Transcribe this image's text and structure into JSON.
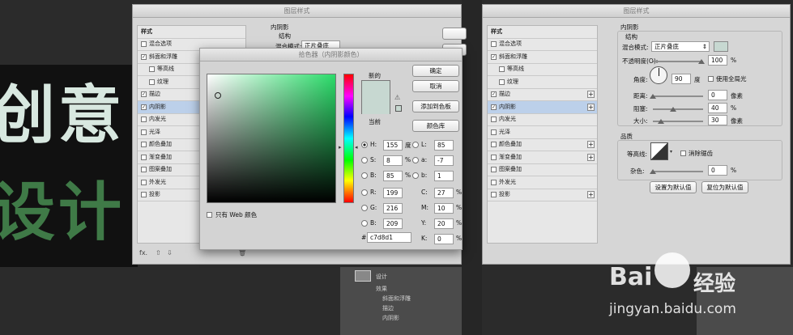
{
  "layer_style_left": {
    "title": "图层样式",
    "styles_header": "样式",
    "items": [
      {
        "label": "混合选项",
        "checked": false
      },
      {
        "label": "斜面和浮雕",
        "checked": true
      },
      {
        "label": "等高线",
        "checked": false
      },
      {
        "label": "纹理",
        "checked": false
      },
      {
        "label": "描边",
        "checked": true
      },
      {
        "label": "内阴影",
        "checked": true
      },
      {
        "label": "内发光",
        "checked": false
      },
      {
        "label": "光泽",
        "checked": false
      },
      {
        "label": "颜色叠加",
        "checked": false
      },
      {
        "label": "渐变叠加",
        "checked": false
      },
      {
        "label": "图案叠加",
        "checked": false
      },
      {
        "label": "外发光",
        "checked": false
      },
      {
        "label": "投影",
        "checked": false
      }
    ],
    "section_title": "内阴影",
    "structure": "结构",
    "blend_mode_label": "混合模式:",
    "blend_mode_value": "正片叠底",
    "fx_label": "fx."
  },
  "color_picker": {
    "title": "拾色器（内阴影颜色）",
    "new_label": "新的",
    "current_label": "当前",
    "ok_button": "确定",
    "cancel_button": "取消",
    "add_swatch_button": "添加到色板",
    "libraries_button": "颜色库",
    "web_only_label": "只有 Web 颜色",
    "hsb": [
      {
        "key": "H:",
        "value": "155",
        "unit": "度"
      },
      {
        "key": "S:",
        "value": "8",
        "unit": "%"
      },
      {
        "key": "B:",
        "value": "85",
        "unit": "%"
      }
    ],
    "rgb": [
      {
        "key": "R:",
        "value": "199"
      },
      {
        "key": "G:",
        "value": "216"
      },
      {
        "key": "B:",
        "value": "209"
      }
    ],
    "lab": [
      {
        "key": "L:",
        "value": "85"
      },
      {
        "key": "a:",
        "value": "-7"
      },
      {
        "key": "b:",
        "value": "1"
      }
    ],
    "cmyk": [
      {
        "key": "C:",
        "value": "27",
        "unit": "%"
      },
      {
        "key": "M:",
        "value": "10",
        "unit": "%"
      },
      {
        "key": "Y:",
        "value": "20",
        "unit": "%"
      },
      {
        "key": "K:",
        "value": "0",
        "unit": "%"
      }
    ],
    "hex_label": "#",
    "hex_value": "c7d8d1",
    "swatch_color": "#c7d8d1"
  },
  "layer_style_right": {
    "title": "图层样式",
    "styles_header": "样式",
    "items": [
      {
        "label": "混合选项",
        "checked": false,
        "plus": false
      },
      {
        "label": "斜面和浮雕",
        "checked": true,
        "plus": false
      },
      {
        "label": "等高线",
        "checked": false,
        "plus": false
      },
      {
        "label": "纹理",
        "checked": false,
        "plus": false
      },
      {
        "label": "描边",
        "checked": true,
        "plus": true
      },
      {
        "label": "内阴影",
        "checked": true,
        "plus": true
      },
      {
        "label": "内发光",
        "checked": false,
        "plus": false
      },
      {
        "label": "光泽",
        "checked": false,
        "plus": false
      },
      {
        "label": "颜色叠加",
        "checked": false,
        "plus": true
      },
      {
        "label": "渐变叠加",
        "checked": false,
        "plus": true
      },
      {
        "label": "图案叠加",
        "checked": false,
        "plus": false
      },
      {
        "label": "外发光",
        "checked": false,
        "plus": false
      },
      {
        "label": "投影",
        "checked": false,
        "plus": true
      }
    ],
    "section_title": "内阴影",
    "structure": "结构",
    "blend_mode_label": "混合模式:",
    "blend_mode_value": "正片叠底",
    "opacity_label": "不透明度(O):",
    "opacity_value": "100",
    "angle_label": "角度:",
    "angle_value": "90",
    "angle_unit": "度",
    "global_light_label": "使用全局光",
    "distance_label": "距离:",
    "distance_value": "0",
    "choke_label": "阻塞:",
    "choke_value": "40",
    "size_label": "大小:",
    "size_value": "30",
    "px_unit": "像素",
    "pct_unit": "%",
    "quality_title": "品质",
    "contour_label": "等高线:",
    "antialias_label": "消除锯齿",
    "noise_label": "杂色:",
    "noise_value": "0",
    "default_button": "设置为默认值",
    "reset_button": "复位为默认值"
  },
  "canvas_text": {
    "line1": "创意",
    "line2": "设计"
  },
  "layers_panel": {
    "layer_name": "设计",
    "effects": "效果",
    "sub": [
      "斜面和浮雕",
      "描边",
      "内阴影"
    ]
  },
  "watermark": {
    "logo": "Bai",
    "logo2": "经验",
    "url": "jingyan.baidu.com"
  }
}
